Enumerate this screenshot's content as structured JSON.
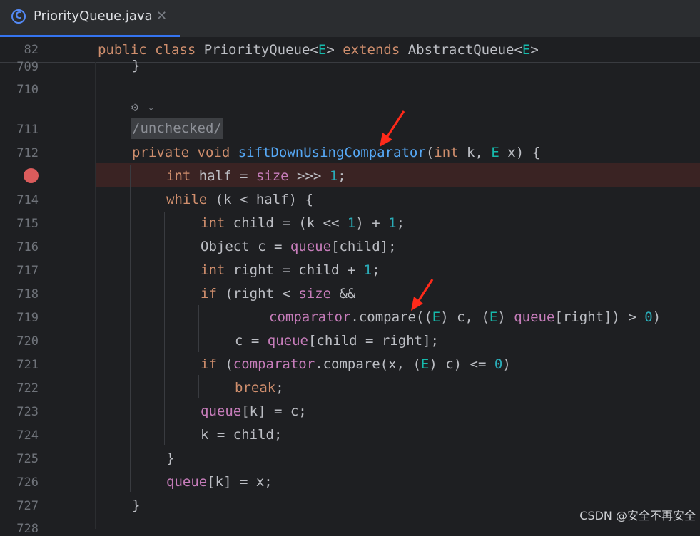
{
  "tab": {
    "label": "PriorityQueue.java",
    "icon": "C",
    "close": "✕"
  },
  "sticky": {
    "line": "82",
    "code": "public class PriorityQueue<E> extends AbstractQueue<E>"
  },
  "gutter": {
    "lines": [
      "709",
      "710",
      "711",
      "712",
      "714",
      "715",
      "716",
      "717",
      "718",
      "719",
      "720",
      "721",
      "722",
      "723",
      "724",
      "725",
      "726",
      "727",
      "728"
    ]
  },
  "code": {
    "l709": "}",
    "suppress": "/unchecked/",
    "l712_kw": "private void ",
    "l712_fn": "siftDownUsingComparator",
    "l712_rest_open": "(",
    "l712_int": "int",
    "l712_k": " k, ",
    "l712_E": "E",
    "l712_x": " x) {",
    "l713_int": "int",
    "l713_a": " half = ",
    "l713_size": "size",
    "l713_b": " >>> ",
    "l713_1": "1",
    "l713_c": ";",
    "l714_while": "while",
    "l714_rest": " (k < half) {",
    "l715_int": "int",
    "l715_a": " child = (k << ",
    "l715_1": "1",
    "l715_b": ") + ",
    "l715_1b": "1",
    "l715_c": ";",
    "l716_a": "Object c = ",
    "l716_queue": "queue",
    "l716_b": "[child];",
    "l717_int": "int",
    "l717_a": " right = child + ",
    "l717_1": "1",
    "l717_b": ";",
    "l718_if": "if",
    "l718_a": " (right < ",
    "l718_size": "size",
    "l718_b": " &&",
    "l719_comp": "comparator",
    "l719_a": ".compare((",
    "l719_E": "E",
    "l719_b": ") c, (",
    "l719_E2": "E",
    "l719_c": ") ",
    "l719_queue": "queue",
    "l719_d": "[right]) > ",
    "l719_0": "0",
    "l719_e": ")",
    "l720_a": "c = ",
    "l720_queue": "queue",
    "l720_b": "[child = right];",
    "l721_if": "if",
    "l721_a": " (",
    "l721_comp": "comparator",
    "l721_b": ".compare(x, (",
    "l721_E": "E",
    "l721_c": ") c) <= ",
    "l721_0": "0",
    "l721_d": ")",
    "l722_break": "break",
    "l722_a": ";",
    "l723_queue": "queue",
    "l723_a": "[k] = c;",
    "l724": "k = child;",
    "l725": "}",
    "l726_queue": "queue",
    "l726_a": "[k] = x;",
    "l727": "}"
  },
  "watermark": "CSDN @安全不再安全",
  "colors": {
    "background": "#1e1f22",
    "keyword": "#cf8e6d",
    "function": "#56a8f5",
    "field": "#c77dbb",
    "number": "#2aacb8",
    "type_param": "#16baac",
    "breakpoint": "#db5c5c",
    "arrow": "#ff2a1a"
  }
}
